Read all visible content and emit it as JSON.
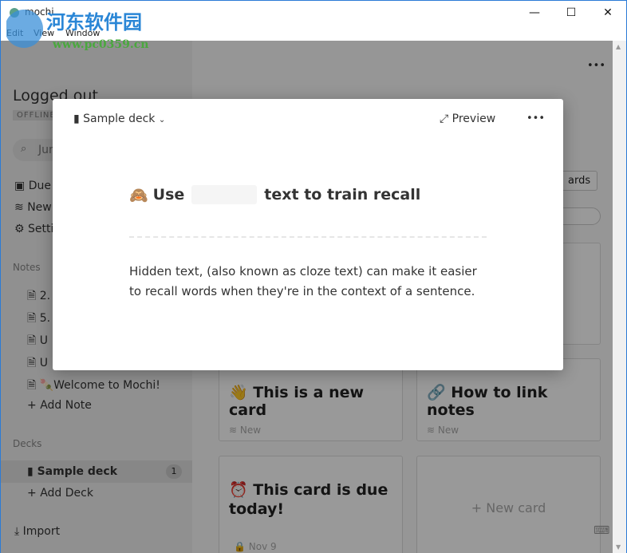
{
  "window": {
    "title": "mochi",
    "minimize": "—",
    "maximize": "☐",
    "close": "✕"
  },
  "menu": [
    "Edit",
    "View",
    "Window"
  ],
  "watermark": {
    "line1": "河东软件园",
    "line2": "www.pc0359.cn"
  },
  "sidebar": {
    "account": "Logged out",
    "status_badge": "OFFLINE",
    "search_placeholder": "Jump to...",
    "nav": [
      "Due",
      "New",
      "Settings"
    ],
    "notes_header": "Notes",
    "notes": [
      "2.",
      "5.",
      "U",
      "U",
      "Welcome to Mochi!"
    ],
    "add_note": "Add Note",
    "decks_header": "Decks",
    "decks": [
      {
        "name": "Sample deck",
        "count": "1"
      }
    ],
    "add_deck": "Add Deck",
    "import": "Import"
  },
  "main": {
    "more": "•••",
    "review_button": "ards",
    "cards": [
      {
        "title": "This is a new card",
        "emoji": "👋",
        "meta": "New"
      },
      {
        "title": "How to link notes",
        "emoji": "🔗",
        "meta": "New"
      },
      {
        "title": "This card is due today!",
        "emoji": "⏰",
        "meta": "Nov 9"
      }
    ],
    "new_card": "+ New card"
  },
  "modal": {
    "deck": "Sample deck",
    "preview": "Preview",
    "more": "•••",
    "heading_emoji": "🙈",
    "heading_before": "Use",
    "heading_after": "text to train recall",
    "body": "Hidden text, (also known as cloze text) can make it easier to recall words when they're in the context of a sentence."
  }
}
